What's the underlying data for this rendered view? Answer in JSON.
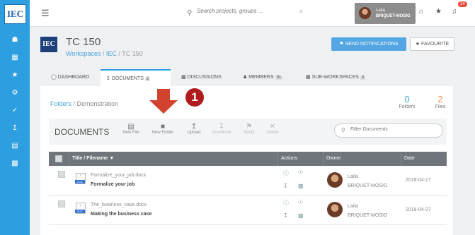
{
  "brand": {
    "logo_text": "IEC"
  },
  "topbar": {
    "search_placeholder": "Search projects, groups ...",
    "search_clear": "×",
    "user_first": "Laila",
    "user_last": "BRIQUET-MOSIG",
    "notifications_count": "14"
  },
  "workspace": {
    "logo_text": "IEC",
    "title": "TC 150",
    "breadcrumb": [
      "Workspaces",
      "IEC",
      "TC 150"
    ],
    "send_notifications_label": "SEND NOTIFICATIONS",
    "favourite_label": "FAVOURITE"
  },
  "tabs": [
    {
      "label": "DASHBOARD",
      "count": ""
    },
    {
      "label": "DOCUMENTS",
      "count": "2"
    },
    {
      "label": "DISCUSSIONS",
      "count": ""
    },
    {
      "label": "MEMBERS",
      "count": "91"
    },
    {
      "label": "SUB-WORKSPACES",
      "count": "3"
    }
  ],
  "documents": {
    "crumb_root": "Folders",
    "crumb_current": "Demonstration",
    "folders_count": "0",
    "folders_label": "Folders",
    "files_count": "2",
    "files_label": "Files",
    "heading": "DOCUMENTS",
    "tools": [
      "New File",
      "New Folder",
      "Upload",
      "Download",
      "Notify",
      "Delete"
    ],
    "filter_placeholder": "Filter Documents",
    "step_number": "1",
    "columns": [
      "Title / Filename ▼",
      "Actions",
      "Owner",
      "Date"
    ],
    "rows": [
      {
        "filename": "Formalize_your_job.docx",
        "title": "Formalize your job",
        "owner_first": "Laila",
        "owner_last": "BRIQUET-MOSIG",
        "date": "2018-04-27",
        "type_tag": "DOC"
      },
      {
        "filename": "The_business_case.docx",
        "title": "Making the business case",
        "owner_first": "Laila",
        "owner_last": "BRIQUET-MOSIG",
        "date": "2018-04-27",
        "type_tag": "DOC"
      }
    ]
  },
  "colors": {
    "sidebar": "#2d9fe0",
    "primary": "#53a6e3",
    "table_header": "#6f757b",
    "accent_red": "#b01c1c",
    "files_count": "#f0964e"
  }
}
